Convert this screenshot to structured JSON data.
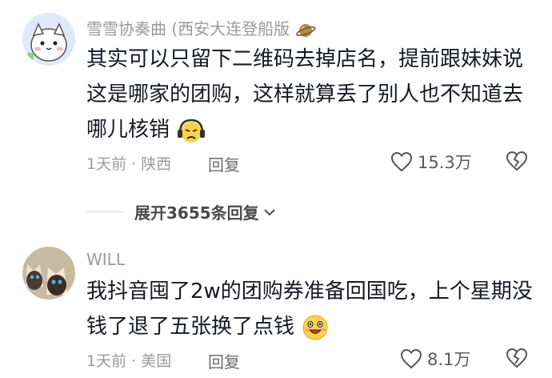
{
  "comments": [
    {
      "username": "雪雪协奏曲 (西安大连登船版",
      "badge_icon": "planet-icon",
      "lines": [
        "其实可以只留下二维码去掉店名，提前跟妹妹说",
        "这是哪家的团购，这样就算丢了别人也不知道去",
        "哪儿核销"
      ],
      "emoji": "sad-headphones-emoji",
      "time": "1天前",
      "location": "陕西",
      "reply_label": "回复",
      "likes": "15.3万"
    },
    {
      "username": "WILL",
      "lines": [
        "我抖音囤了2w的团购券准备回国吃，上个星期没",
        "钱了退了五张换了点钱"
      ],
      "emoji": "grinning-emoji",
      "time": "1天前",
      "location": "美国",
      "reply_label": "回复",
      "likes": "8.1万"
    }
  ],
  "expand_replies": "展开3655条回复",
  "separator": "·",
  "colors": {
    "text": "#161823",
    "muted": "#9a9a9a"
  }
}
